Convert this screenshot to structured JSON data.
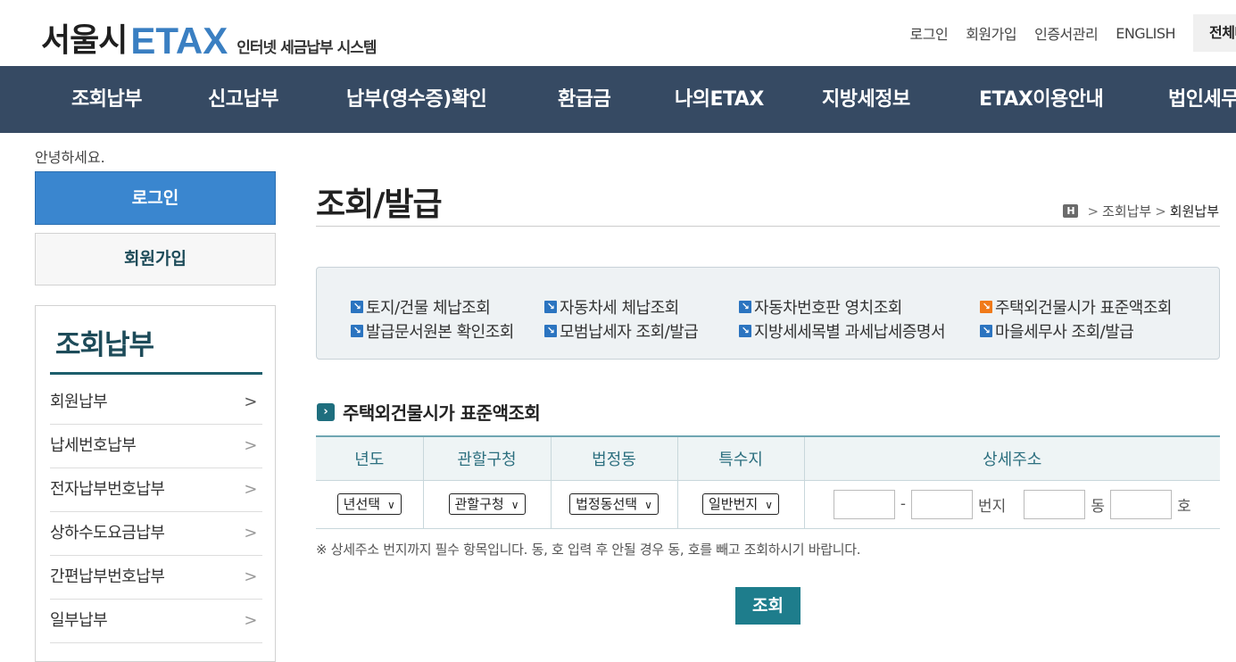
{
  "header": {
    "logo_city": "서울시",
    "logo_brand": "ETAX",
    "logo_sub": "인터넷 세금납부 시스템",
    "util": [
      "로그인",
      "회원가입",
      "인증서관리",
      "ENGLISH"
    ],
    "all_menu": "전체메뉴"
  },
  "gnb": [
    "조회납부",
    "신고납부",
    "납부(영수증)확인",
    "환급금",
    "나의ETAX",
    "지방세정보",
    "ETAX이용안내",
    "법인세무"
  ],
  "left": {
    "greeting": "안녕하세요.",
    "login": "로그인",
    "join": "회원가입",
    "lnb_title": "조회납부",
    "items": [
      "회원납부",
      "납세번호납부",
      "전자납부번호납부",
      "상하수도요금납부",
      "간편납부번호납부",
      "일부납부"
    ]
  },
  "main": {
    "title": "조회/발급",
    "breadcrumb": [
      "H",
      "조회납부",
      "회원납부"
    ],
    "quick_links": [
      [
        "토지/건물 체납조회",
        "자동차세 체납조회",
        "자동차번호판 영치조회",
        "주택외건물시가 표준액조회"
      ],
      [
        "발급문서원본 확인조회",
        "모범납세자 조회/발급",
        "지방세세목별 과세납세증명서",
        "마을세무사 조회/발급"
      ]
    ],
    "section_title": "주택외건물시가 표준액조회",
    "table_headers": [
      "년도",
      "관할구청",
      "법정동",
      "특수지",
      "상세주소"
    ],
    "selects": [
      "년선택",
      "관할구청",
      "법정동선택",
      "일반번지"
    ],
    "addr_labels": [
      "-",
      "번지",
      "동",
      "호"
    ],
    "notice": "※ 상세주소 번지까지 필수 항목입니다. 동, 호 입력 후 안될 경우 동, 호를 빼고 조회하시기 바랍니다.",
    "search_button": "조회"
  }
}
